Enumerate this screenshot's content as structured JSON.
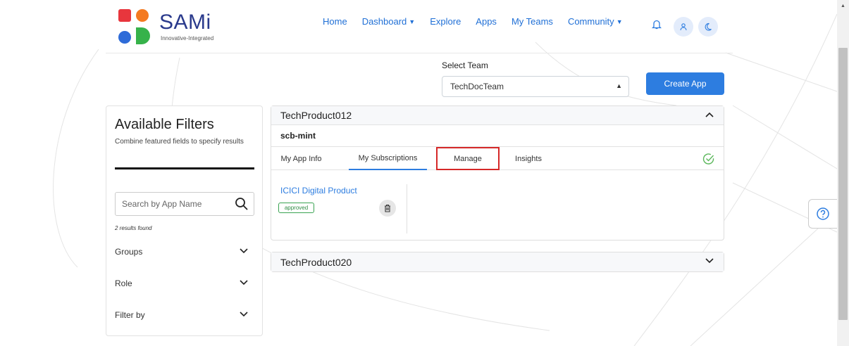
{
  "brand": {
    "name": "SAMi",
    "tagline": "Innovative-Integrated",
    "colors": {
      "orange": "#f47a20",
      "red": "#e8363d",
      "blue": "#2e6bd8",
      "green": "#36b24a",
      "navy": "#2a3a8c"
    }
  },
  "nav": {
    "items": [
      {
        "label": "Home",
        "dropdown": false
      },
      {
        "label": "Dashboard",
        "dropdown": true
      },
      {
        "label": "Explore",
        "dropdown": false
      },
      {
        "label": "Apps",
        "dropdown": false
      },
      {
        "label": "My Teams",
        "dropdown": false
      },
      {
        "label": "Community",
        "dropdown": true
      }
    ],
    "icons": [
      "bell-icon",
      "user-icon",
      "moon-icon"
    ]
  },
  "team": {
    "label": "Select Team",
    "selected": "TechDocTeam"
  },
  "create_app_label": "Create App",
  "filters": {
    "title": "Available Filters",
    "subtitle": "Combine featured fields to specify results",
    "search_placeholder": "Search by App Name",
    "results_text": "2 results found",
    "facets": [
      "Groups",
      "Role",
      "Filter by"
    ]
  },
  "products": [
    {
      "name": "TechProduct012",
      "expanded": true,
      "app_name": "scb-mint",
      "tabs": [
        {
          "label": "My App Info",
          "state": "normal"
        },
        {
          "label": "My Subscriptions",
          "state": "active"
        },
        {
          "label": "Manage",
          "state": "highlighted"
        },
        {
          "label": "Insights",
          "state": "normal"
        }
      ],
      "subscriptions": [
        {
          "name": "ICICI Digital Product",
          "status": "approved"
        }
      ]
    },
    {
      "name": "TechProduct020",
      "expanded": false
    }
  ],
  "accent_color": "#2d7de0",
  "highlight_color": "#d62828",
  "approved_color": "#3aa352"
}
